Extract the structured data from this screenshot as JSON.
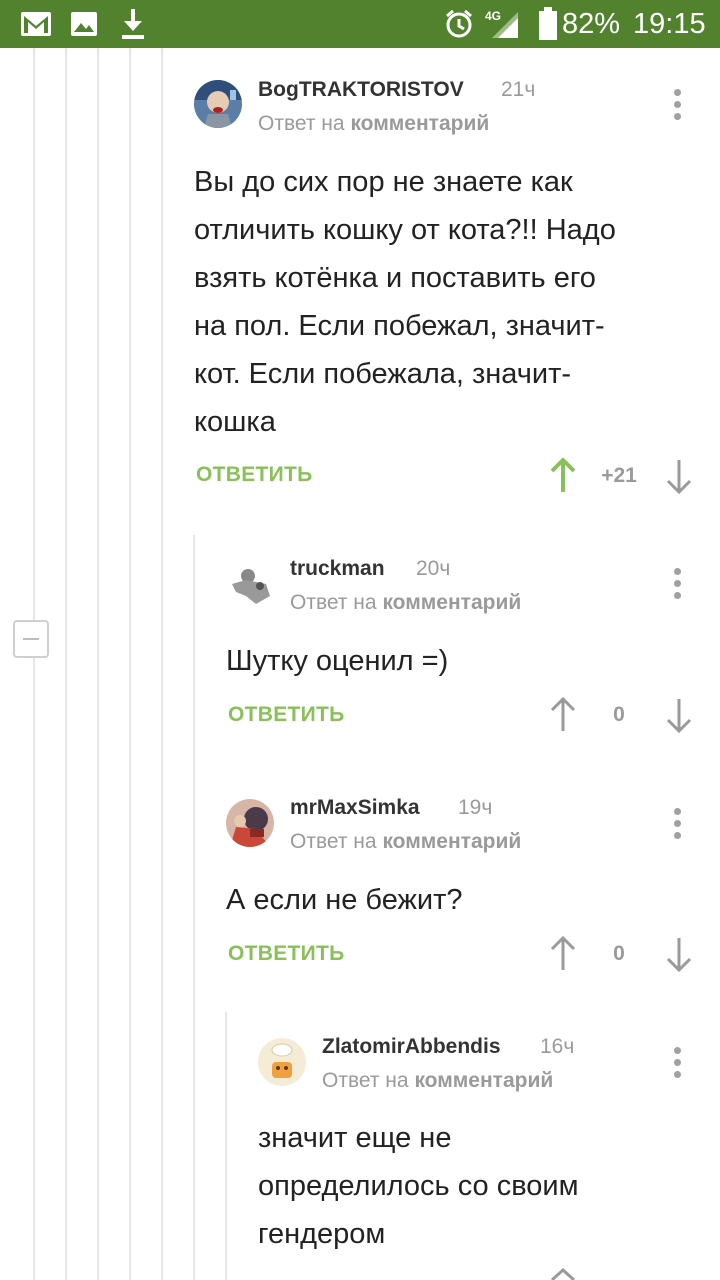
{
  "status_bar": {
    "battery": "82%",
    "time": "19:15",
    "network": "4G",
    "color": "#53822f",
    "icons": [
      "gmail-icon",
      "gallery-icon",
      "download-icon",
      "alarm-icon",
      "signal-icon",
      "battery-icon"
    ]
  },
  "labels": {
    "reply_to_prefix": "Ответ на",
    "reply_to_link": "комментарий",
    "reply_button": "ОТВЕТИТЬ"
  },
  "comments": [
    {
      "author": "BogTRAKTORISTOV",
      "time": "21ч",
      "text": "Вы до сих пор не знаете как\nотличить кошку от кота?!! Надо\nвзять котёнка и поставить его\nна пол. Если побежал, значит-\nкот. Если побежала, значит-\nкошка",
      "rating": "+21",
      "upvoted": true
    },
    {
      "author": "truckman",
      "time": "20ч",
      "text": "Шутку оценил =)",
      "rating": "0",
      "upvoted": false
    },
    {
      "author": "mrMaxSimka",
      "time": "19ч",
      "text": "А если не бежит?",
      "rating": "0",
      "upvoted": false
    },
    {
      "author": "ZlatomirAbbendis",
      "time": "16ч",
      "text": "значит еще не\nопределилось со своим\nгендером",
      "rating": "",
      "upvoted": false
    }
  ],
  "colors": {
    "accent_green": "#8ac05a",
    "upvote_active": "#8ac05a",
    "muted": "#9a9a9a"
  }
}
